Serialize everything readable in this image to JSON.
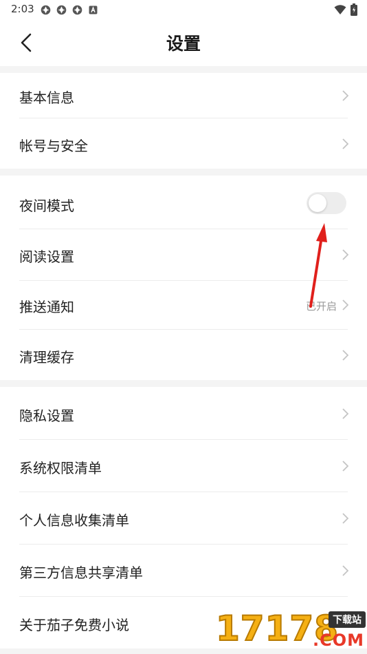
{
  "status_bar": {
    "time": "2:03",
    "left_icons": [
      "app-notification-icon",
      "app-notification-icon",
      "app-notification-icon",
      "keyboard-a-icon"
    ],
    "right_icons": [
      "wifi-icon",
      "battery-icon"
    ]
  },
  "header": {
    "title": "设置",
    "back_icon": "chevron-left-icon"
  },
  "groups": [
    {
      "items": [
        {
          "label": "基本信息",
          "type": "link"
        },
        {
          "label": "帐号与安全",
          "type": "link"
        }
      ]
    },
    {
      "items": [
        {
          "label": "夜间模式",
          "type": "toggle",
          "on": false
        },
        {
          "label": "阅读设置",
          "type": "link"
        },
        {
          "label": "推送通知",
          "type": "link",
          "value": "已开启"
        },
        {
          "label": "清理缓存",
          "type": "link"
        }
      ]
    },
    {
      "items": [
        {
          "label": "隐私设置",
          "type": "link"
        },
        {
          "label": "系统权限清单",
          "type": "link"
        },
        {
          "label": "个人信息收集清单",
          "type": "link"
        },
        {
          "label": "第三方信息共享清单",
          "type": "link"
        },
        {
          "label": "关于茄子免费小说",
          "type": "link"
        }
      ]
    }
  ],
  "watermark": {
    "number": "17178",
    "badge": "下载站",
    "suffix": ".COM"
  },
  "colors": {
    "annotation_arrow": "#e0201c",
    "group_gap": "#f4f4f4",
    "toggle_off": "#ededed"
  }
}
